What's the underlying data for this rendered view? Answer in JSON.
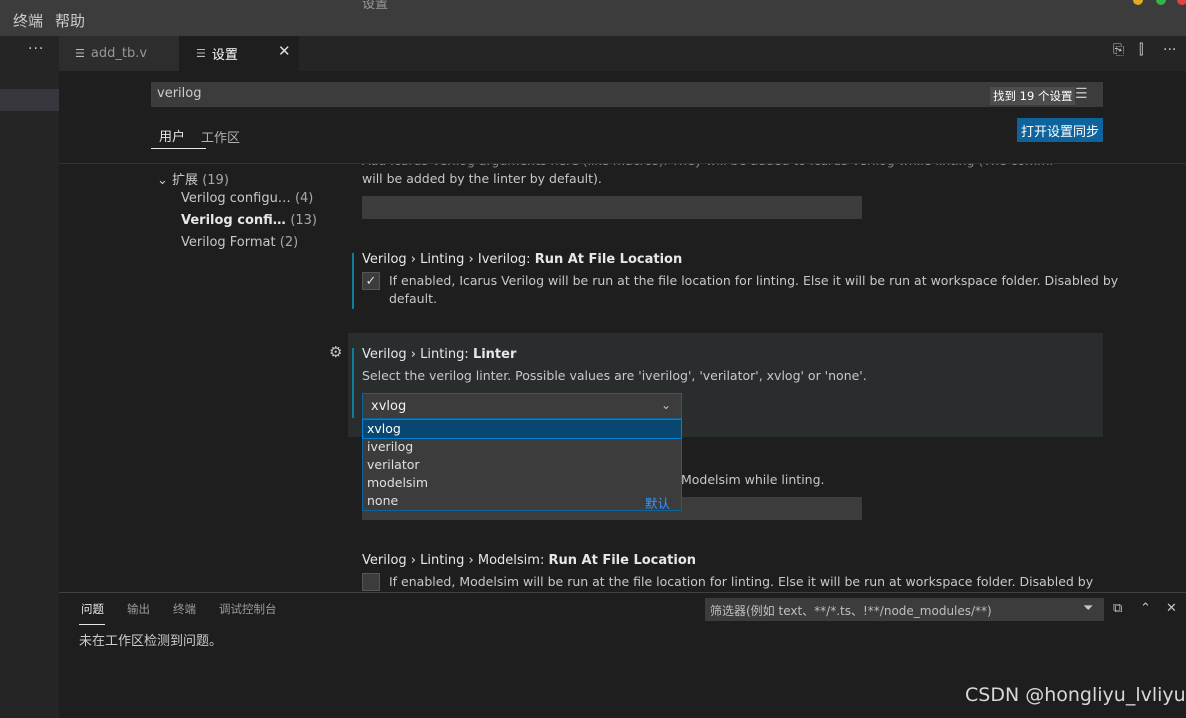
{
  "window": {
    "title": "设置"
  },
  "menu": {
    "items": [
      "终端",
      "帮助"
    ]
  },
  "sidebar": {
    "more_label": "···"
  },
  "tabs": [
    {
      "label": "add_tb.v",
      "icon": "lines-icon"
    },
    {
      "label": "设置",
      "icon": "lines-icon",
      "close": "✕"
    }
  ],
  "toolbar": {
    "open_json": "⎘",
    "split": "⫿",
    "more": "···"
  },
  "search": {
    "value": "verilog",
    "count": "找到 19 个设置",
    "filter_icon": "☰"
  },
  "scopes": {
    "user": "用户",
    "workspace": "工作区",
    "sync_button": "打开设置同步"
  },
  "toc": {
    "group": {
      "label": "扩展",
      "count": "(19)"
    },
    "items": [
      {
        "label": "Verilog configu…",
        "count": "(4)"
      },
      {
        "label": "Verilog confi…",
        "count": "(13)"
      },
      {
        "label": "Verilog Format",
        "count": "(2)"
      }
    ]
  },
  "settings": {
    "top_desc_partial": "Add Icarus Verilog arguments here (like macros). They will be added to Icarus Verilog while linting (The command -t null",
    "top_desc_line2": "will be added by the linter by default).",
    "iverilog_run_at_file": {
      "prefix": "Verilog › Linting › Iverilog: ",
      "name": "Run At File Location",
      "desc1": "If enabled, Icarus Verilog will be run at the file location for linting. Else it will be run at workspace folder. Disabled by",
      "desc2": "default.",
      "checked": "✓"
    },
    "linter": {
      "prefix": "Verilog › Linting: ",
      "name": "Linter",
      "desc": "Select the verilog linter. Possible values are 'iverilog', 'verilator', xvlog' or 'none'.",
      "value": "xvlog",
      "options": [
        "xvlog",
        "iverilog",
        "verilator",
        "modelsim",
        "none"
      ],
      "default_label": "默认"
    },
    "modelsim_args_partial": "Modelsim while linting.",
    "modelsim_run_at_file": {
      "prefix": "Verilog › Linting › Modelsim: ",
      "name": "Run At File Location",
      "desc1": "If enabled, Modelsim will be run at the file location for linting. Else it will be run at workspace folder. Disabled by"
    }
  },
  "panel": {
    "tabs": [
      "问题",
      "输出",
      "终端",
      "调试控制台"
    ],
    "filter_placeholder": "筛选器(例如 text、**/*.ts、!**/node_modules/**)",
    "message": "未在工作区检测到问题。"
  },
  "watermark": "CSDN @hongliyu_lvliyu",
  "colors": {
    "accent": "#0e639c",
    "modified": "#0c7d9d",
    "selected_option": "#094771"
  }
}
